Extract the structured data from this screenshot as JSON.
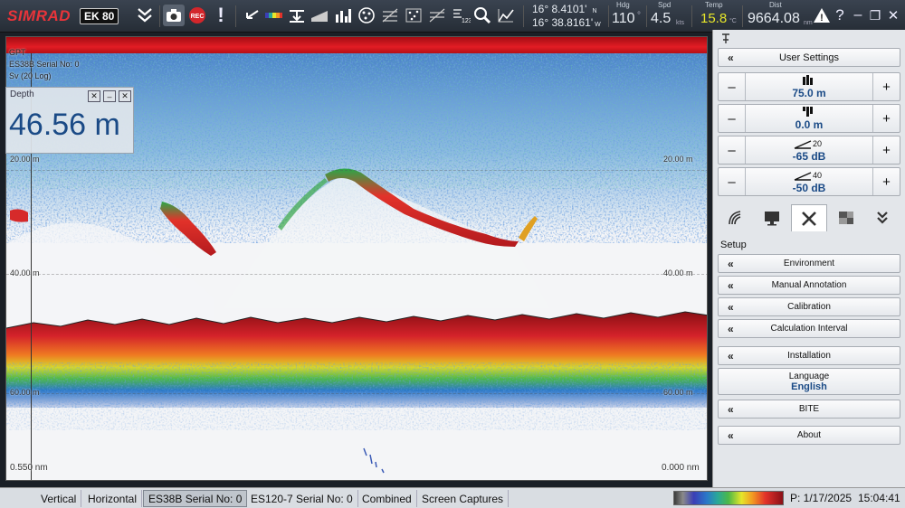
{
  "app": {
    "brand": "SIMRAD",
    "model": "EK 80"
  },
  "toolbar": {
    "icons": [
      "double-chevron-down-icon",
      "camera-icon",
      "record-icon",
      "alert-icon",
      "arrow-left-icon",
      "color-bar-icon",
      "depth-marker-icon",
      "bottom-icon",
      "bar-chart-icon",
      "target-icon",
      "grid-icon",
      "scatter-icon",
      "waves-icon",
      "numbers-icon",
      "zoom-icon",
      "chart-icon"
    ],
    "record_label": "REC"
  },
  "position": {
    "lat": "16° 8.4101'",
    "lat_dir": "N",
    "lon": "16° 38.8161'",
    "lon_dir": "W"
  },
  "readouts": {
    "hdg": {
      "label": "Hdg",
      "value": "110",
      "unit": "°"
    },
    "spd": {
      "label": "Spd",
      "value": "4.5",
      "unit": "kts"
    },
    "temp": {
      "label": "Temp",
      "value": "15.8",
      "unit": "°C"
    },
    "dist": {
      "label": "Dist",
      "value": "9664.08",
      "unit": "nm"
    }
  },
  "window_controls": {
    "warning": "!",
    "help": "?",
    "minimize": "–",
    "restore": "❐",
    "close": "✕"
  },
  "echogram": {
    "info_lines": [
      "GPT",
      "ES38B Serial No: 0",
      "Sv (20 Log)"
    ],
    "left_bottom_range": "0.550 nm",
    "right_bottom_range": "0.000 nm",
    "depth_labels_left": [
      "20.00 m",
      "40.00 m",
      "60.00 m"
    ],
    "depth_labels_right": [
      "20.00 m",
      "40.00 m",
      "60.00 m"
    ]
  },
  "depth_box": {
    "title": "Depth",
    "value": "46.56 m"
  },
  "panel": {
    "user_settings": "User Settings",
    "steppers": [
      {
        "name": "range",
        "value": "75.0 m",
        "glyph": "▮▮"
      },
      {
        "name": "start",
        "value": "0.0 m",
        "glyph": "▮▮"
      },
      {
        "name": "gain",
        "value": "-65 dB",
        "glyph": "20"
      },
      {
        "name": "gain2",
        "value": "-50 dB",
        "glyph": "40"
      }
    ],
    "stepper_minus": "–",
    "stepper_plus": "+",
    "setup_label": "Setup",
    "menu": [
      {
        "label": "Environment"
      },
      {
        "label": "Manual Annotation"
      },
      {
        "label": "Calibration"
      },
      {
        "label": "Calculation Interval"
      },
      {
        "label": "Installation"
      },
      {
        "label": "BITE"
      },
      {
        "label": "About"
      }
    ],
    "language": {
      "label": "Language",
      "value": "English"
    },
    "tabs": [
      "signal-icon",
      "monitor-icon",
      "tools-icon",
      "windows-icon",
      "arrows-down-icon"
    ]
  },
  "bottom_tabs": [
    "Vertical",
    "Horizontal",
    "ES38B Serial No: 0",
    "ES120-7 Serial No: 0",
    "Combined",
    "Screen Captures"
  ],
  "status": {
    "date": "P: 1/17/2025",
    "time": "15:04:41"
  }
}
